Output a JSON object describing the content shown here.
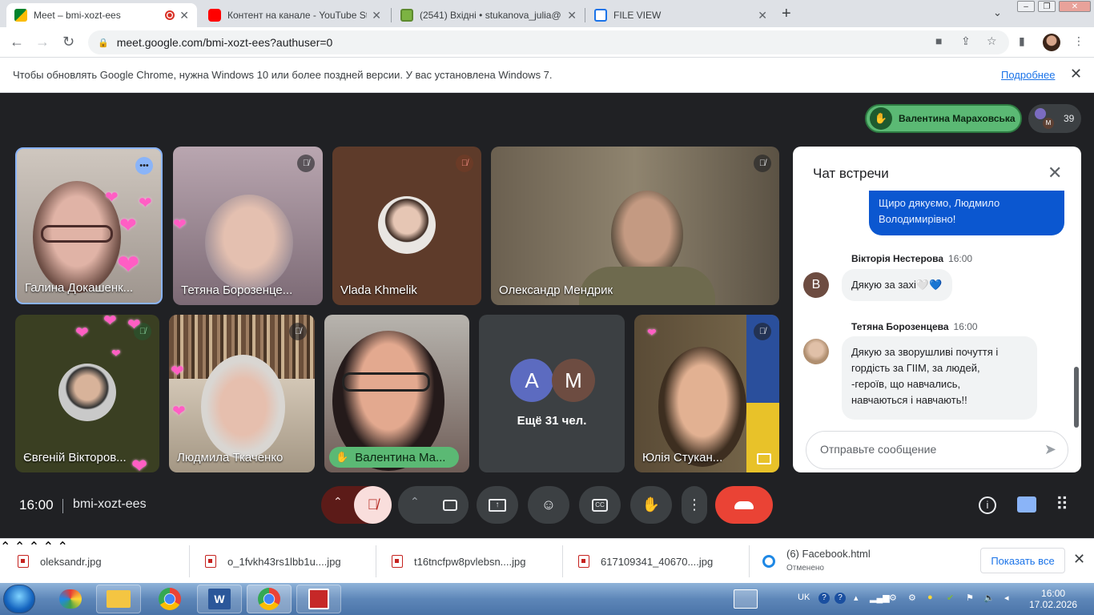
{
  "browser": {
    "tabs": [
      {
        "title": "Meet – bmi-xozt-ees",
        "close": "✕",
        "active": true
      },
      {
        "title": "Контент на канале - YouTube Stu",
        "close": "✕"
      },
      {
        "title": "(2541) Вхідні • stukanova_julia@",
        "close": "✕"
      },
      {
        "title": "FILE VIEW",
        "close": "✕"
      }
    ],
    "new_tab": "+",
    "url": "meet.google.com/bmi-xozt-ees?authuser=0",
    "info_message": "Чтобы обновлять Google Chrome, нужна Windows 10 или более поздней версии. У вас установлена Windows 7.",
    "info_link": "Подробнее"
  },
  "meet": {
    "presenter_name": "Валентина Мараховська",
    "participant_count": "39",
    "people_avatar_letter": "М",
    "tiles": [
      {
        "name": "Галина Докашенк..."
      },
      {
        "name": "Тетяна Борозенце..."
      },
      {
        "name": "Vlada Khmelik"
      },
      {
        "name": "Олександр Мендрик"
      },
      {
        "name": "Євгеній Вікторов..."
      },
      {
        "name": "Людмила Ткаченко"
      },
      {
        "name": "Валентина Ма..."
      },
      {
        "name": "Ещё 31 чел.",
        "avatars": [
          "A",
          "M"
        ]
      },
      {
        "name": "Юлія Стукан..."
      }
    ],
    "meeting_time": "16:00",
    "meeting_code": "bmi-xozt-ees"
  },
  "chat": {
    "title": "Чат встречи",
    "messages": [
      {
        "self": true,
        "text": "Щиро дякуємо, Людмило Володимирівно!"
      },
      {
        "sender": "Вікторія Нестерова",
        "time": "16:00",
        "avatar": "В",
        "text": "Дякую за захі🤍💙"
      },
      {
        "sender": "Тетяна Борозенцева",
        "time": "16:00",
        "lines": [
          "Дякую за зворушливі почуття і",
          "гордість за ГІІМ, за людей,",
          "-героїв,  що навчались,",
          "навчаються  і навчають!!"
        ]
      }
    ],
    "input_placeholder": "Отправьте сообщение"
  },
  "downloads": {
    "items": [
      {
        "name": "oleksandr.jpg"
      },
      {
        "name": "o_1fvkh43rs1lbb1u....jpg"
      },
      {
        "name": "t16tncfpw8pvlebsn....jpg"
      },
      {
        "name": "617109341_40670....jpg"
      },
      {
        "name": "(6) Facebook.html",
        "status": "Отменено"
      }
    ],
    "show_all": "Показать все"
  },
  "taskbar": {
    "lang": "UK",
    "time": "16:00",
    "date": "17.02.2026"
  },
  "colors": {
    "meet_bg": "#202124",
    "presenter_green": "#5bb974",
    "end_call_red": "#ea4335",
    "mic_off_red": "#f9dedc",
    "chat_self_blue": "#0b57d0"
  }
}
